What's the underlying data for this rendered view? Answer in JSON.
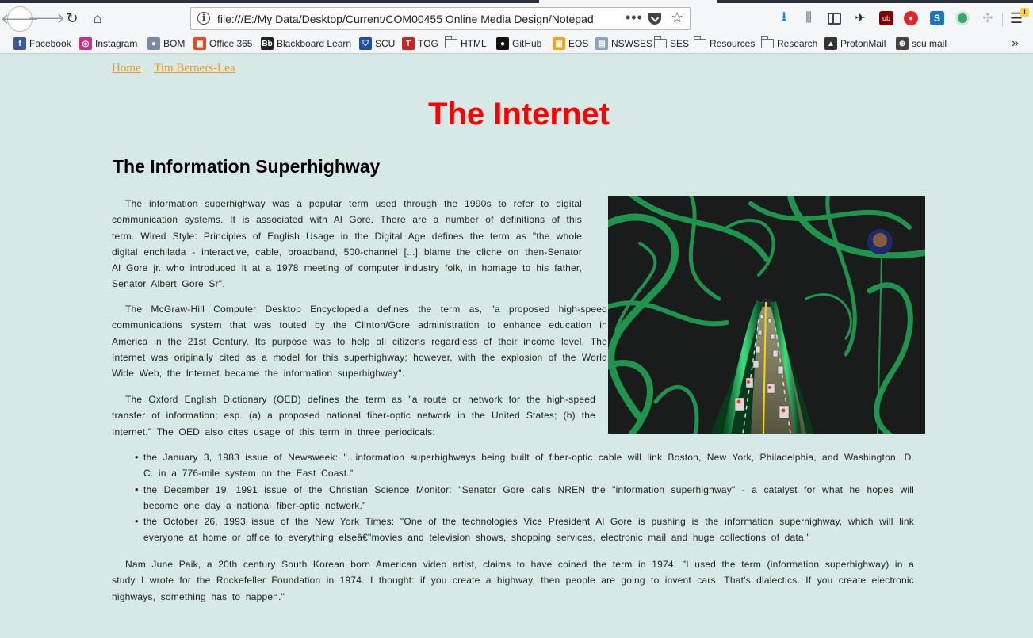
{
  "browser": {
    "url": "file:///E:/My Data/Desktop/Current/COM00455 Online Media Design/Notepad",
    "overflow_dots": "•••"
  },
  "bookmarks": [
    {
      "label": "Facebook",
      "icon": "facebook-icon",
      "color": "#3b5998",
      "glyph": "f"
    },
    {
      "label": "Instagram",
      "icon": "instagram-icon",
      "color": "#c13584",
      "glyph": "◎"
    },
    {
      "label": "BOM",
      "icon": "bom-icon",
      "color": "#7a8aa0",
      "glyph": "●"
    },
    {
      "label": "Office 365",
      "icon": "office-icon",
      "color": "#e74a1c",
      "glyph": "▦"
    },
    {
      "label": "Blackboard Learn",
      "icon": "blackboard-icon",
      "color": "#222222",
      "glyph": "Bb"
    },
    {
      "label": "SCU",
      "icon": "scu-shield-icon",
      "color": "#1a4fa3",
      "glyph": "⛉"
    },
    {
      "label": "TOG",
      "icon": "tog-icon",
      "color": "#cc2222",
      "glyph": "T"
    },
    {
      "label": "HTML",
      "icon": "folder-icon",
      "color": "",
      "glyph": ""
    },
    {
      "label": "GitHub",
      "icon": "github-icon",
      "color": "#111111",
      "glyph": "●"
    },
    {
      "label": "EOS",
      "icon": "eos-icon",
      "color": "#f3a21b",
      "glyph": "▣"
    },
    {
      "label": "NSWSES",
      "icon": "nswses-icon",
      "color": "#8aa2c0",
      "glyph": "▤"
    },
    {
      "label": "SES",
      "icon": "folder-icon",
      "color": "",
      "glyph": ""
    },
    {
      "label": "Resources",
      "icon": "folder-icon",
      "color": "",
      "glyph": ""
    },
    {
      "label": "Research",
      "icon": "folder-icon",
      "color": "",
      "glyph": ""
    },
    {
      "label": "ProtonMail",
      "icon": "protonmail-icon",
      "color": "#333333",
      "glyph": "▲"
    },
    {
      "label": "scu mail",
      "icon": "globe-icon",
      "color": "#444444",
      "glyph": "⊕"
    }
  ],
  "nav": {
    "home": "Home",
    "tbl": "Tim Berners-Lea"
  },
  "page_title": "The Internet",
  "section_heading": "The Information Superhighway",
  "paragraphs": {
    "p1": "The information superhighway was a popular term used through the 1990s to refer to digital communication systems. It is associated with Al Gore. There are a number of definitions of this term. Wired Style: Principles of English Usage in the Digital Age defines the term as \"the whole digital enchilada - interactive, cable, broadband, 500-channel [...] blame the cliche on then-Senator Al Gore jr. who introduced it at a 1978 meeting of computer industry folk, in homage to his father, Senator Albert Gore Sr\".",
    "p2": "The McGraw-Hill Computer Desktop Encyclopedia defines the term as, \"a proposed high-speed communications system that was touted by the Clinton/Gore administration to enhance education in America in the 21st Century. Its purpose was to help all citizens regardless of their income level. The Internet was originally cited as a model for this superhighway; however, with the explosion of the World Wide Web, the Internet became the information superhighway\".",
    "p3": "The Oxford English Dictionary (OED) defines the term as \"a route or network for the high-speed transfer of information; esp. (a) a proposed national fiber-optic network in the United States; (b) the Internet.\" The OED also cites usage of this term in three periodicals:",
    "p4": "Nam June Paik, a 20th century South Korean born American video artist, claims to have coined the term in 1974. \"I used the term (information superhighway) in a study I wrote for the Rockefeller Foundation in 1974. I thought: if you create a highway, then people are going to invent cars. That's dialectics. If you create electronic highways, something has to happen.\""
  },
  "quotes": [
    "the January 3, 1983 issue of Newsweek: \"...information superhighways being built of fiber-optic cable will link Boston, New York, Philadelphia, and Washington, D. C. in a 776-mile system on the East Coast.\"",
    "the December 19, 1991 issue of the Christian Science Monitor: \"Senator Gore calls NREN the \"information superhighway\" - a catalyst for what he hopes will become one day a national fiber-optic network.\"",
    "the October 26, 1993 issue of the New York Times: \"One of the technologies Vice President Al Gore is pushing is the information superhighway, which will link everyone at home or office to everything elseâ€\"movies and television shows, shopping services, electronic mail and huge collections of data.\""
  ],
  "colors": {
    "page_bg": "#d6e9e7",
    "title": "#ff0000",
    "link": "#e69b24"
  }
}
